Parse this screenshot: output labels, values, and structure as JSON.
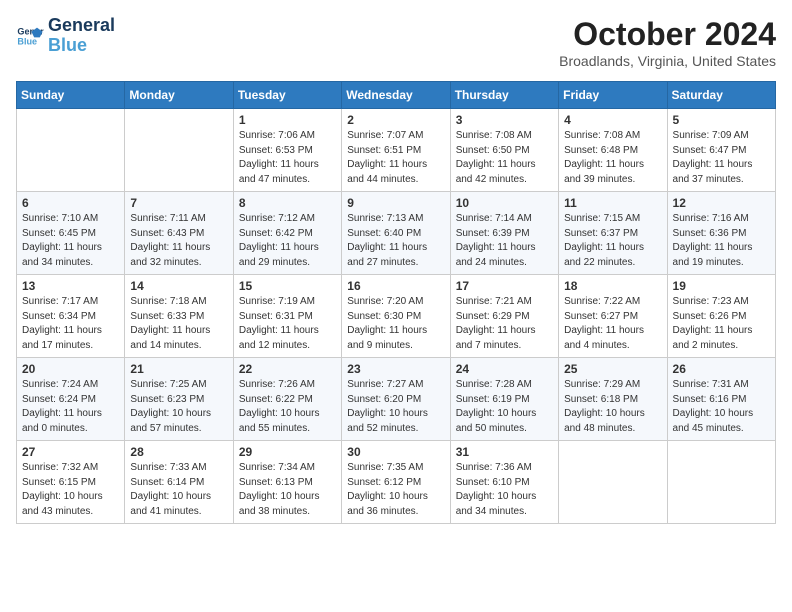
{
  "header": {
    "logo_line1": "General",
    "logo_line2": "Blue",
    "month_title": "October 2024",
    "location": "Broadlands, Virginia, United States"
  },
  "weekdays": [
    "Sunday",
    "Monday",
    "Tuesday",
    "Wednesday",
    "Thursday",
    "Friday",
    "Saturday"
  ],
  "weeks": [
    [
      {
        "day": "",
        "detail": ""
      },
      {
        "day": "",
        "detail": ""
      },
      {
        "day": "1",
        "detail": "Sunrise: 7:06 AM\nSunset: 6:53 PM\nDaylight: 11 hours and 47 minutes."
      },
      {
        "day": "2",
        "detail": "Sunrise: 7:07 AM\nSunset: 6:51 PM\nDaylight: 11 hours and 44 minutes."
      },
      {
        "day": "3",
        "detail": "Sunrise: 7:08 AM\nSunset: 6:50 PM\nDaylight: 11 hours and 42 minutes."
      },
      {
        "day": "4",
        "detail": "Sunrise: 7:08 AM\nSunset: 6:48 PM\nDaylight: 11 hours and 39 minutes."
      },
      {
        "day": "5",
        "detail": "Sunrise: 7:09 AM\nSunset: 6:47 PM\nDaylight: 11 hours and 37 minutes."
      }
    ],
    [
      {
        "day": "6",
        "detail": "Sunrise: 7:10 AM\nSunset: 6:45 PM\nDaylight: 11 hours and 34 minutes."
      },
      {
        "day": "7",
        "detail": "Sunrise: 7:11 AM\nSunset: 6:43 PM\nDaylight: 11 hours and 32 minutes."
      },
      {
        "day": "8",
        "detail": "Sunrise: 7:12 AM\nSunset: 6:42 PM\nDaylight: 11 hours and 29 minutes."
      },
      {
        "day": "9",
        "detail": "Sunrise: 7:13 AM\nSunset: 6:40 PM\nDaylight: 11 hours and 27 minutes."
      },
      {
        "day": "10",
        "detail": "Sunrise: 7:14 AM\nSunset: 6:39 PM\nDaylight: 11 hours and 24 minutes."
      },
      {
        "day": "11",
        "detail": "Sunrise: 7:15 AM\nSunset: 6:37 PM\nDaylight: 11 hours and 22 minutes."
      },
      {
        "day": "12",
        "detail": "Sunrise: 7:16 AM\nSunset: 6:36 PM\nDaylight: 11 hours and 19 minutes."
      }
    ],
    [
      {
        "day": "13",
        "detail": "Sunrise: 7:17 AM\nSunset: 6:34 PM\nDaylight: 11 hours and 17 minutes."
      },
      {
        "day": "14",
        "detail": "Sunrise: 7:18 AM\nSunset: 6:33 PM\nDaylight: 11 hours and 14 minutes."
      },
      {
        "day": "15",
        "detail": "Sunrise: 7:19 AM\nSunset: 6:31 PM\nDaylight: 11 hours and 12 minutes."
      },
      {
        "day": "16",
        "detail": "Sunrise: 7:20 AM\nSunset: 6:30 PM\nDaylight: 11 hours and 9 minutes."
      },
      {
        "day": "17",
        "detail": "Sunrise: 7:21 AM\nSunset: 6:29 PM\nDaylight: 11 hours and 7 minutes."
      },
      {
        "day": "18",
        "detail": "Sunrise: 7:22 AM\nSunset: 6:27 PM\nDaylight: 11 hours and 4 minutes."
      },
      {
        "day": "19",
        "detail": "Sunrise: 7:23 AM\nSunset: 6:26 PM\nDaylight: 11 hours and 2 minutes."
      }
    ],
    [
      {
        "day": "20",
        "detail": "Sunrise: 7:24 AM\nSunset: 6:24 PM\nDaylight: 11 hours and 0 minutes."
      },
      {
        "day": "21",
        "detail": "Sunrise: 7:25 AM\nSunset: 6:23 PM\nDaylight: 10 hours and 57 minutes."
      },
      {
        "day": "22",
        "detail": "Sunrise: 7:26 AM\nSunset: 6:22 PM\nDaylight: 10 hours and 55 minutes."
      },
      {
        "day": "23",
        "detail": "Sunrise: 7:27 AM\nSunset: 6:20 PM\nDaylight: 10 hours and 52 minutes."
      },
      {
        "day": "24",
        "detail": "Sunrise: 7:28 AM\nSunset: 6:19 PM\nDaylight: 10 hours and 50 minutes."
      },
      {
        "day": "25",
        "detail": "Sunrise: 7:29 AM\nSunset: 6:18 PM\nDaylight: 10 hours and 48 minutes."
      },
      {
        "day": "26",
        "detail": "Sunrise: 7:31 AM\nSunset: 6:16 PM\nDaylight: 10 hours and 45 minutes."
      }
    ],
    [
      {
        "day": "27",
        "detail": "Sunrise: 7:32 AM\nSunset: 6:15 PM\nDaylight: 10 hours and 43 minutes."
      },
      {
        "day": "28",
        "detail": "Sunrise: 7:33 AM\nSunset: 6:14 PM\nDaylight: 10 hours and 41 minutes."
      },
      {
        "day": "29",
        "detail": "Sunrise: 7:34 AM\nSunset: 6:13 PM\nDaylight: 10 hours and 38 minutes."
      },
      {
        "day": "30",
        "detail": "Sunrise: 7:35 AM\nSunset: 6:12 PM\nDaylight: 10 hours and 36 minutes."
      },
      {
        "day": "31",
        "detail": "Sunrise: 7:36 AM\nSunset: 6:10 PM\nDaylight: 10 hours and 34 minutes."
      },
      {
        "day": "",
        "detail": ""
      },
      {
        "day": "",
        "detail": ""
      }
    ]
  ]
}
